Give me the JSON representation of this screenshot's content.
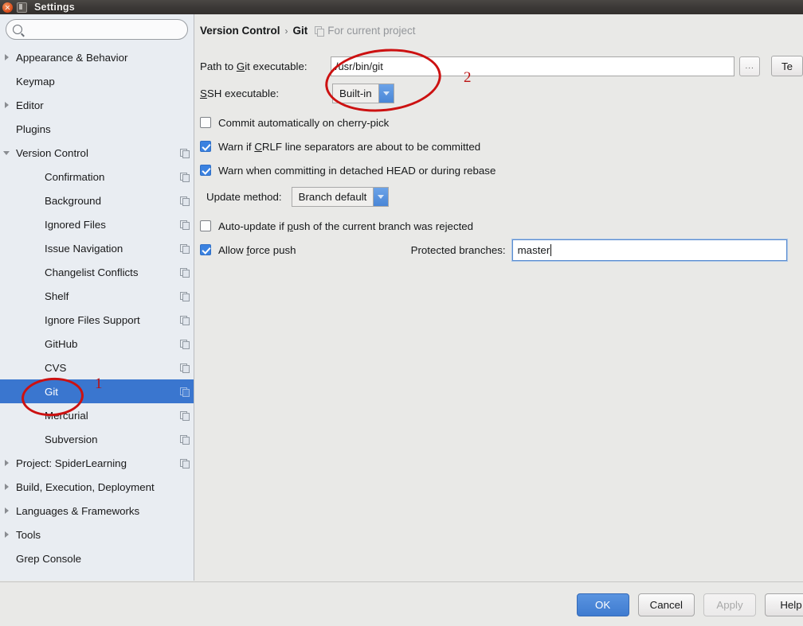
{
  "window": {
    "title": "Settings",
    "close_icon": "close-icon",
    "menu_icon": "window-menu-icon"
  },
  "search": {
    "value": "",
    "placeholder": "",
    "icon": "search-icon"
  },
  "sidebar": {
    "items": [
      {
        "label": "Appearance & Behavior",
        "level": 0,
        "arrow": "collapsed",
        "project_icon": false,
        "selected": false
      },
      {
        "label": "Keymap",
        "level": 0,
        "arrow": "none",
        "project_icon": false,
        "selected": false
      },
      {
        "label": "Editor",
        "level": 0,
        "arrow": "collapsed",
        "project_icon": false,
        "selected": false
      },
      {
        "label": "Plugins",
        "level": 0,
        "arrow": "none",
        "project_icon": false,
        "selected": false
      },
      {
        "label": "Version Control",
        "level": 0,
        "arrow": "expanded",
        "project_icon": true,
        "selected": false
      },
      {
        "label": "Confirmation",
        "level": 1,
        "arrow": "none",
        "project_icon": true,
        "selected": false
      },
      {
        "label": "Background",
        "level": 1,
        "arrow": "none",
        "project_icon": true,
        "selected": false
      },
      {
        "label": "Ignored Files",
        "level": 1,
        "arrow": "none",
        "project_icon": true,
        "selected": false
      },
      {
        "label": "Issue Navigation",
        "level": 1,
        "arrow": "none",
        "project_icon": true,
        "selected": false
      },
      {
        "label": "Changelist Conflicts",
        "level": 1,
        "arrow": "none",
        "project_icon": true,
        "selected": false
      },
      {
        "label": "Shelf",
        "level": 1,
        "arrow": "none",
        "project_icon": true,
        "selected": false
      },
      {
        "label": "Ignore Files Support",
        "level": 1,
        "arrow": "none",
        "project_icon": true,
        "selected": false
      },
      {
        "label": "GitHub",
        "level": 1,
        "arrow": "none",
        "project_icon": true,
        "selected": false
      },
      {
        "label": "CVS",
        "level": 1,
        "arrow": "none",
        "project_icon": true,
        "selected": false
      },
      {
        "label": "Git",
        "level": 1,
        "arrow": "none",
        "project_icon": true,
        "selected": true
      },
      {
        "label": "Mercurial",
        "level": 1,
        "arrow": "none",
        "project_icon": true,
        "selected": false
      },
      {
        "label": "Subversion",
        "level": 1,
        "arrow": "none",
        "project_icon": true,
        "selected": false
      },
      {
        "label": "Project: SpiderLearning",
        "level": 0,
        "arrow": "collapsed",
        "project_icon": true,
        "selected": false
      },
      {
        "label": "Build, Execution, Deployment",
        "level": 0,
        "arrow": "collapsed",
        "project_icon": false,
        "selected": false
      },
      {
        "label": "Languages & Frameworks",
        "level": 0,
        "arrow": "collapsed",
        "project_icon": false,
        "selected": false
      },
      {
        "label": "Tools",
        "level": 0,
        "arrow": "collapsed",
        "project_icon": false,
        "selected": false
      },
      {
        "label": "Grep Console",
        "level": 0,
        "arrow": "none",
        "project_icon": false,
        "selected": false
      }
    ]
  },
  "breadcrumb": {
    "root": "Version Control",
    "separator": "›",
    "leaf": "Git",
    "scope_icon": "project-scope-icon",
    "scope_note": "For current project"
  },
  "form": {
    "path_label_pre": "Path to ",
    "path_label_mnemonic": "G",
    "path_label_post": "it executable:",
    "path_value": "/usr/bin/git",
    "browse_label": "...",
    "test_label": "Te",
    "ssh_label_mnemonic": "S",
    "ssh_label_post": "SH executable:",
    "ssh_value": "Built-in",
    "cb_cherry_pick": "Commit automatically on cherry-pick",
    "cb_cherry_pick_checked": false,
    "cb_crlf_pre": "Warn if ",
    "cb_crlf_mnemonic": "C",
    "cb_crlf_post": "RLF line separators are about to be committed",
    "cb_crlf_checked": true,
    "cb_detached": "Warn when committing in detached HEAD or during rebase",
    "cb_detached_checked": true,
    "update_method_label": "Update method:",
    "update_method_value": "Branch default",
    "cb_autoupdate_pre": "Auto-update if ",
    "cb_autoupdate_mnemonic": "p",
    "cb_autoupdate_post": "ush of the current branch was rejected",
    "cb_autoupdate_checked": false,
    "cb_force_push_pre": "Allow ",
    "cb_force_push_mnemonic": "f",
    "cb_force_push_post": "orce push",
    "cb_force_push_checked": true,
    "protected_label": "Protected branches:",
    "protected_value": "master"
  },
  "footer": {
    "ok": "OK",
    "cancel": "Cancel",
    "apply": "Apply",
    "apply_disabled": true,
    "help": "Help"
  },
  "annotations": [
    {
      "number": "1",
      "target": "sidebar-item-git"
    },
    {
      "number": "2",
      "target": "git-executable-fields"
    }
  ],
  "colors": {
    "selection_blue": "#3a76cf",
    "checkbox_blue": "#3b82e0",
    "annotation_red": "#cc1111",
    "sidebar_bg": "#e9edf2",
    "panel_bg": "#e9e9e7"
  }
}
